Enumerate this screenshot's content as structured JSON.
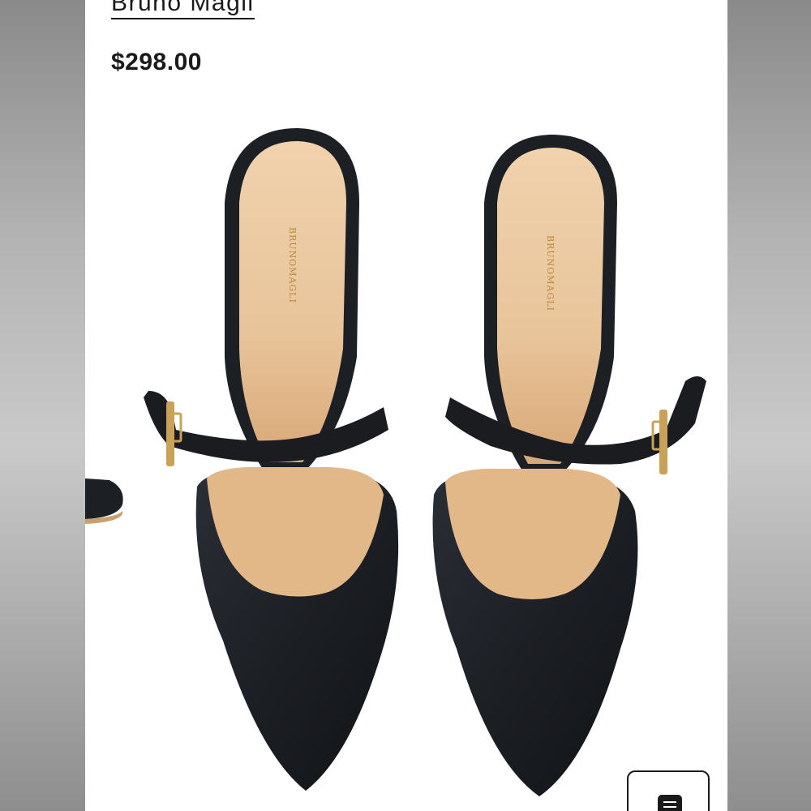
{
  "product": {
    "brand": "Bruno Magli",
    "price": "$298.00"
  },
  "image": {
    "insole_logo_text": "BRUNOMAGLI"
  },
  "icons": {
    "menu": "menu-icon"
  },
  "colors": {
    "leather": "#1c1f24",
    "insole": "#e8c49a",
    "buckle": "#c9a25a"
  }
}
